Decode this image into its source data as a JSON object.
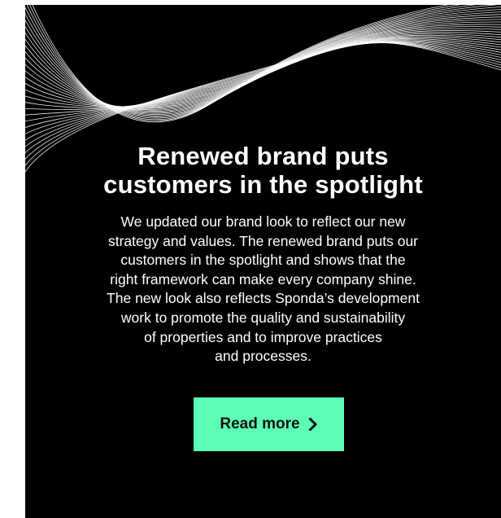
{
  "promo": {
    "headline_lines": [
      "Renewed brand puts",
      "customers in the spotlight"
    ],
    "body_lines": [
      "We updated our brand look to reflect our new",
      "strategy and values. The renewed brand puts our",
      "customers in the spotlight and shows that the",
      "right framework can make every company shine.",
      "The new look also reflects Sponda’s development",
      "work to promote the quality and sustainability",
      "of properties and to improve practices",
      "and processes."
    ],
    "cta_label": "Read more",
    "cta_icon": "chevron-right-icon",
    "decoration_icon": "wave-lines-decoration"
  },
  "colors": {
    "card_background": "#000000",
    "text": "#ffffff",
    "cta_background": "#5cffb4",
    "cta_text": "#111111",
    "lines": "#ffffff"
  }
}
